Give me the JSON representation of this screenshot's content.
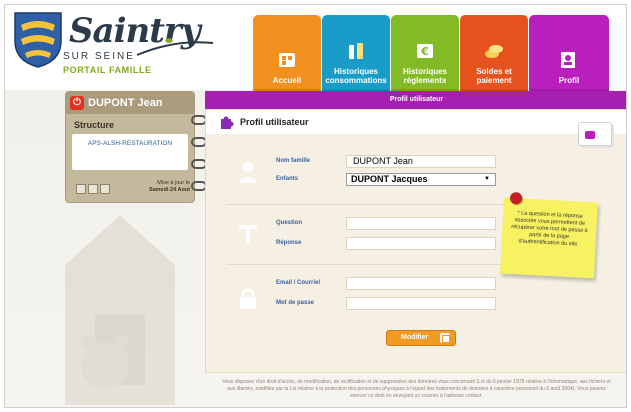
{
  "brand": {
    "title": "Saintry",
    "subtitle": "SUR SEINE",
    "portal": "PORTAIL FAMILLE"
  },
  "tabs": [
    {
      "label": "Accueil",
      "icon": "grid-icon"
    },
    {
      "label": "Historiques consommations",
      "icon": "bottles-icon"
    },
    {
      "label": "Historiques règlements",
      "icon": "euro-icon"
    },
    {
      "label": "Soldes et paiement",
      "icon": "coins-icon"
    },
    {
      "label": "Profil",
      "icon": "profile-icon"
    }
  ],
  "header_bar": {
    "title": "Profil utilisateur"
  },
  "user": {
    "name": "DUPONT Jean",
    "structure_label": "Structure",
    "structure_value": "APS-ALSH-RESTAURATION",
    "update_label": "Mise à jour le",
    "update_date": "Samedi 24 Aout"
  },
  "profile": {
    "title": "Profil utilisateur",
    "nom_famille_label": "Nom famille",
    "nom_famille_value": "DUPONT Jean",
    "enfants_label": "Enfants",
    "enfants_value": "DUPONT Jacques",
    "question_label": "Question",
    "question_value": "",
    "reponse_label": "Réponse",
    "reponse_value": "",
    "email_label": "Email / Courriel",
    "email_value": "",
    "password_label": "Mot de passe",
    "password_value": "",
    "modifier_label": "Modifier"
  },
  "note": {
    "text": "* La question et la réponse associée vous permettent de récupérer votre mot de passe à partir de la page d'authentification du site."
  },
  "footer": {
    "text": "Vous disposez d'un droit d'accès, de modification, de rectification et de suppression des données vous concernant (Loi du 6 janvier 1978 relative à l'informatique, aux fichiers et aux libertés, modifiée par la Loi relative à la protection des personnes physiques à l'égard des traitements de données à caractère personnel du 6 août 2004). Vous pouvez exercer ce droit en envoyant un courrier à l'adresse contact."
  },
  "colors": {
    "accent_purple": "#b81fbd",
    "accueil": "#f2901f",
    "conso": "#1a9cc8",
    "reglements": "#82bb26",
    "solde": "#e5521d",
    "button": "#f19a24",
    "label_blue": "#3c5fa5"
  }
}
